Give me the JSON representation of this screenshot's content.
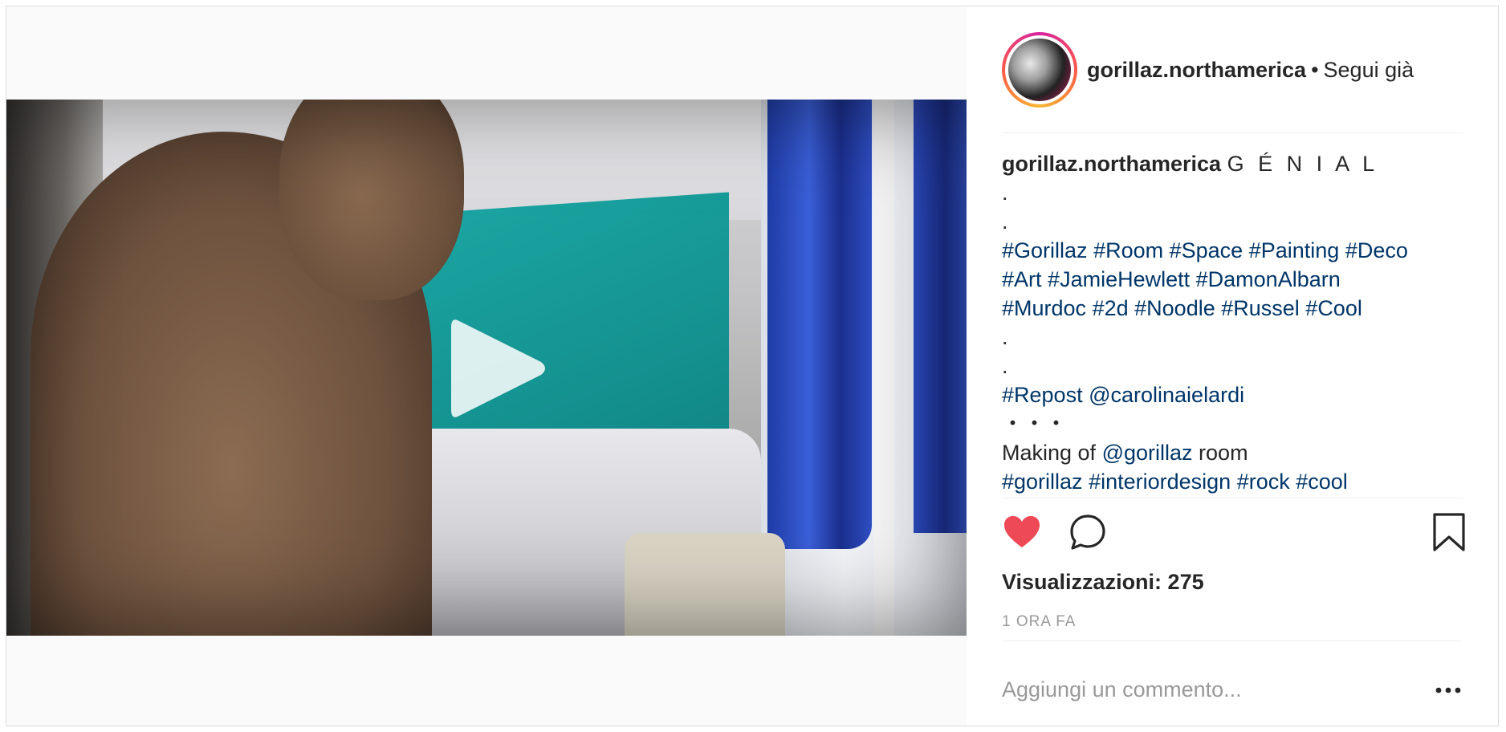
{
  "post": {
    "username": "gorillaz.northamerica",
    "follow_separator": "•",
    "follow_status": "Segui già"
  },
  "caption": {
    "author": "gorillaz.northamerica",
    "text": "G É N I A L",
    "dot_1": ".",
    "dot_2": ".",
    "tags_line_1": [
      "#Gorillaz",
      "#Room",
      "#Space",
      "#Painting",
      "#Deco"
    ],
    "tags_line_2": [
      "#Art",
      "#JamieHewlett",
      "#DamonAlbarn"
    ],
    "tags_line_3": [
      "#Murdoc",
      "#2d",
      "#Noodle",
      "#Russel",
      "#Cool"
    ],
    "dot_3": ".",
    "dot_4": ".",
    "repost_tag": "#Repost",
    "repost_mention": "@carolinaielardi",
    "ellipsis": "・・・",
    "making_of_prefix": "Making of",
    "making_of_mention": "@gorillaz",
    "making_of_suffix": "room",
    "tags_line_4": [
      "#gorillaz",
      "#interiordesign",
      "#rock",
      "#cool"
    ]
  },
  "stats": {
    "views": "Visualizzazioni: 275",
    "time_ago": "1 ORA FA"
  },
  "comment": {
    "placeholder": "Aggiungi un commento..."
  },
  "icons": {
    "play": "play-icon",
    "like": "heart-icon",
    "comment": "comment-icon",
    "save": "bookmark-icon",
    "more": "more-options-icon"
  },
  "colors": {
    "like_active": "#ed4956",
    "hashtag": "#003569",
    "text": "#262626",
    "muted": "#999999",
    "border": "#dbdbdb"
  }
}
